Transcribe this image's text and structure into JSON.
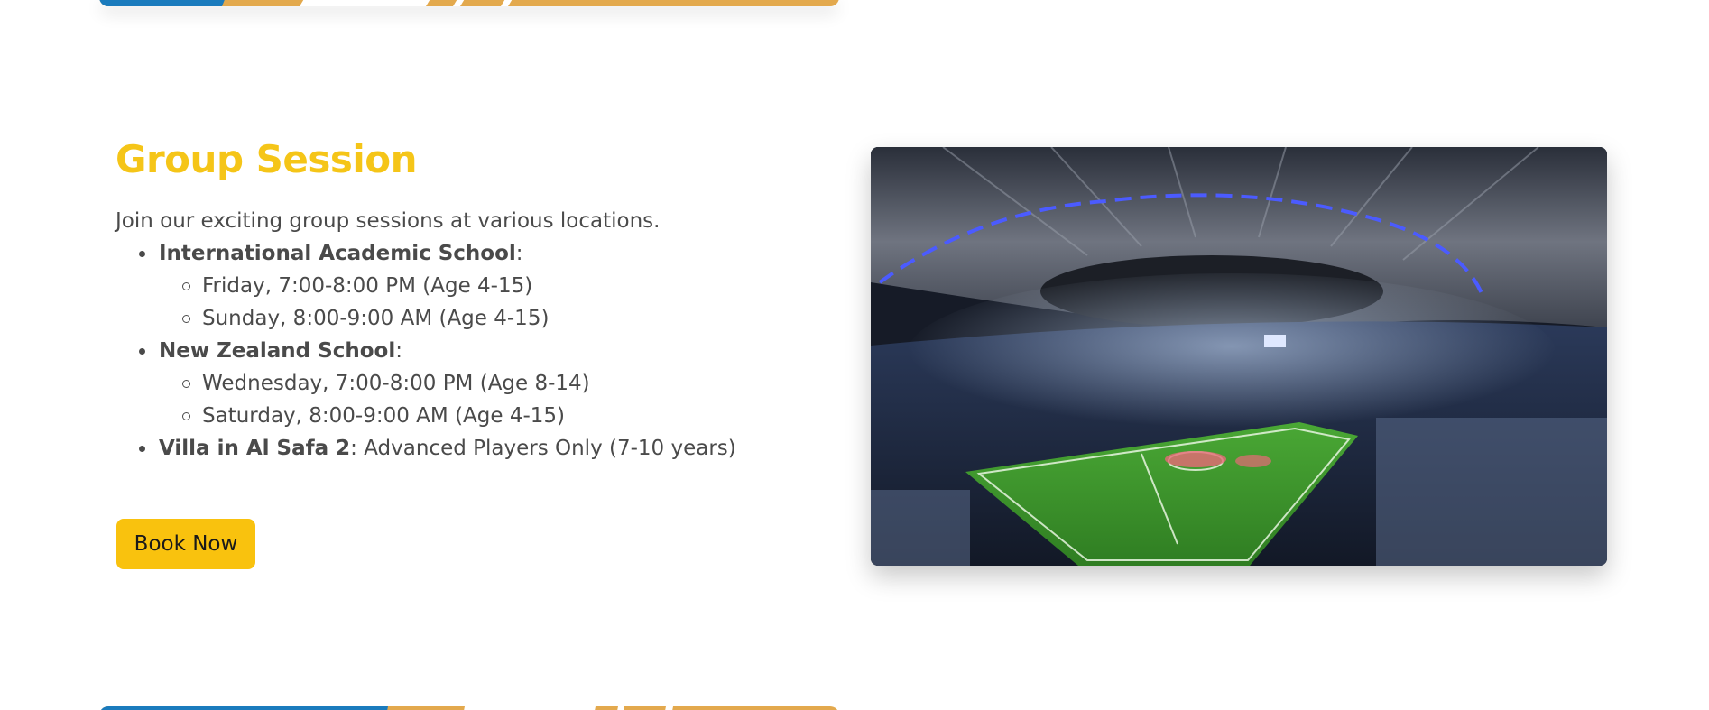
{
  "section": {
    "title": "Group Session",
    "intro": "Join our exciting group sessions at various locations.",
    "locations": [
      {
        "name": "International Academic School",
        "suffix": ":",
        "sessions": [
          "Friday, 7:00-8:00 PM (Age 4-15)",
          "Sunday, 8:00-9:00 AM (Age 4-15)"
        ]
      },
      {
        "name": "New Zealand School",
        "suffix": ":",
        "sessions": [
          "Wednesday, 7:00-8:00 PM (Age 8-14)",
          "Saturday, 8:00-9:00 AM (Age 4-15)"
        ]
      },
      {
        "name": "Villa in Al Safa 2",
        "suffix": ": Advanced Players Only (7-10 years)",
        "sessions": []
      }
    ],
    "button_label": "Book Now"
  },
  "image": {
    "subject": "stadium-photo"
  },
  "colors": {
    "accent": "#f5c518",
    "button": "#f9c20e",
    "stripe_blue": "#1a7bbd",
    "stripe_gold": "#e3a94d"
  }
}
